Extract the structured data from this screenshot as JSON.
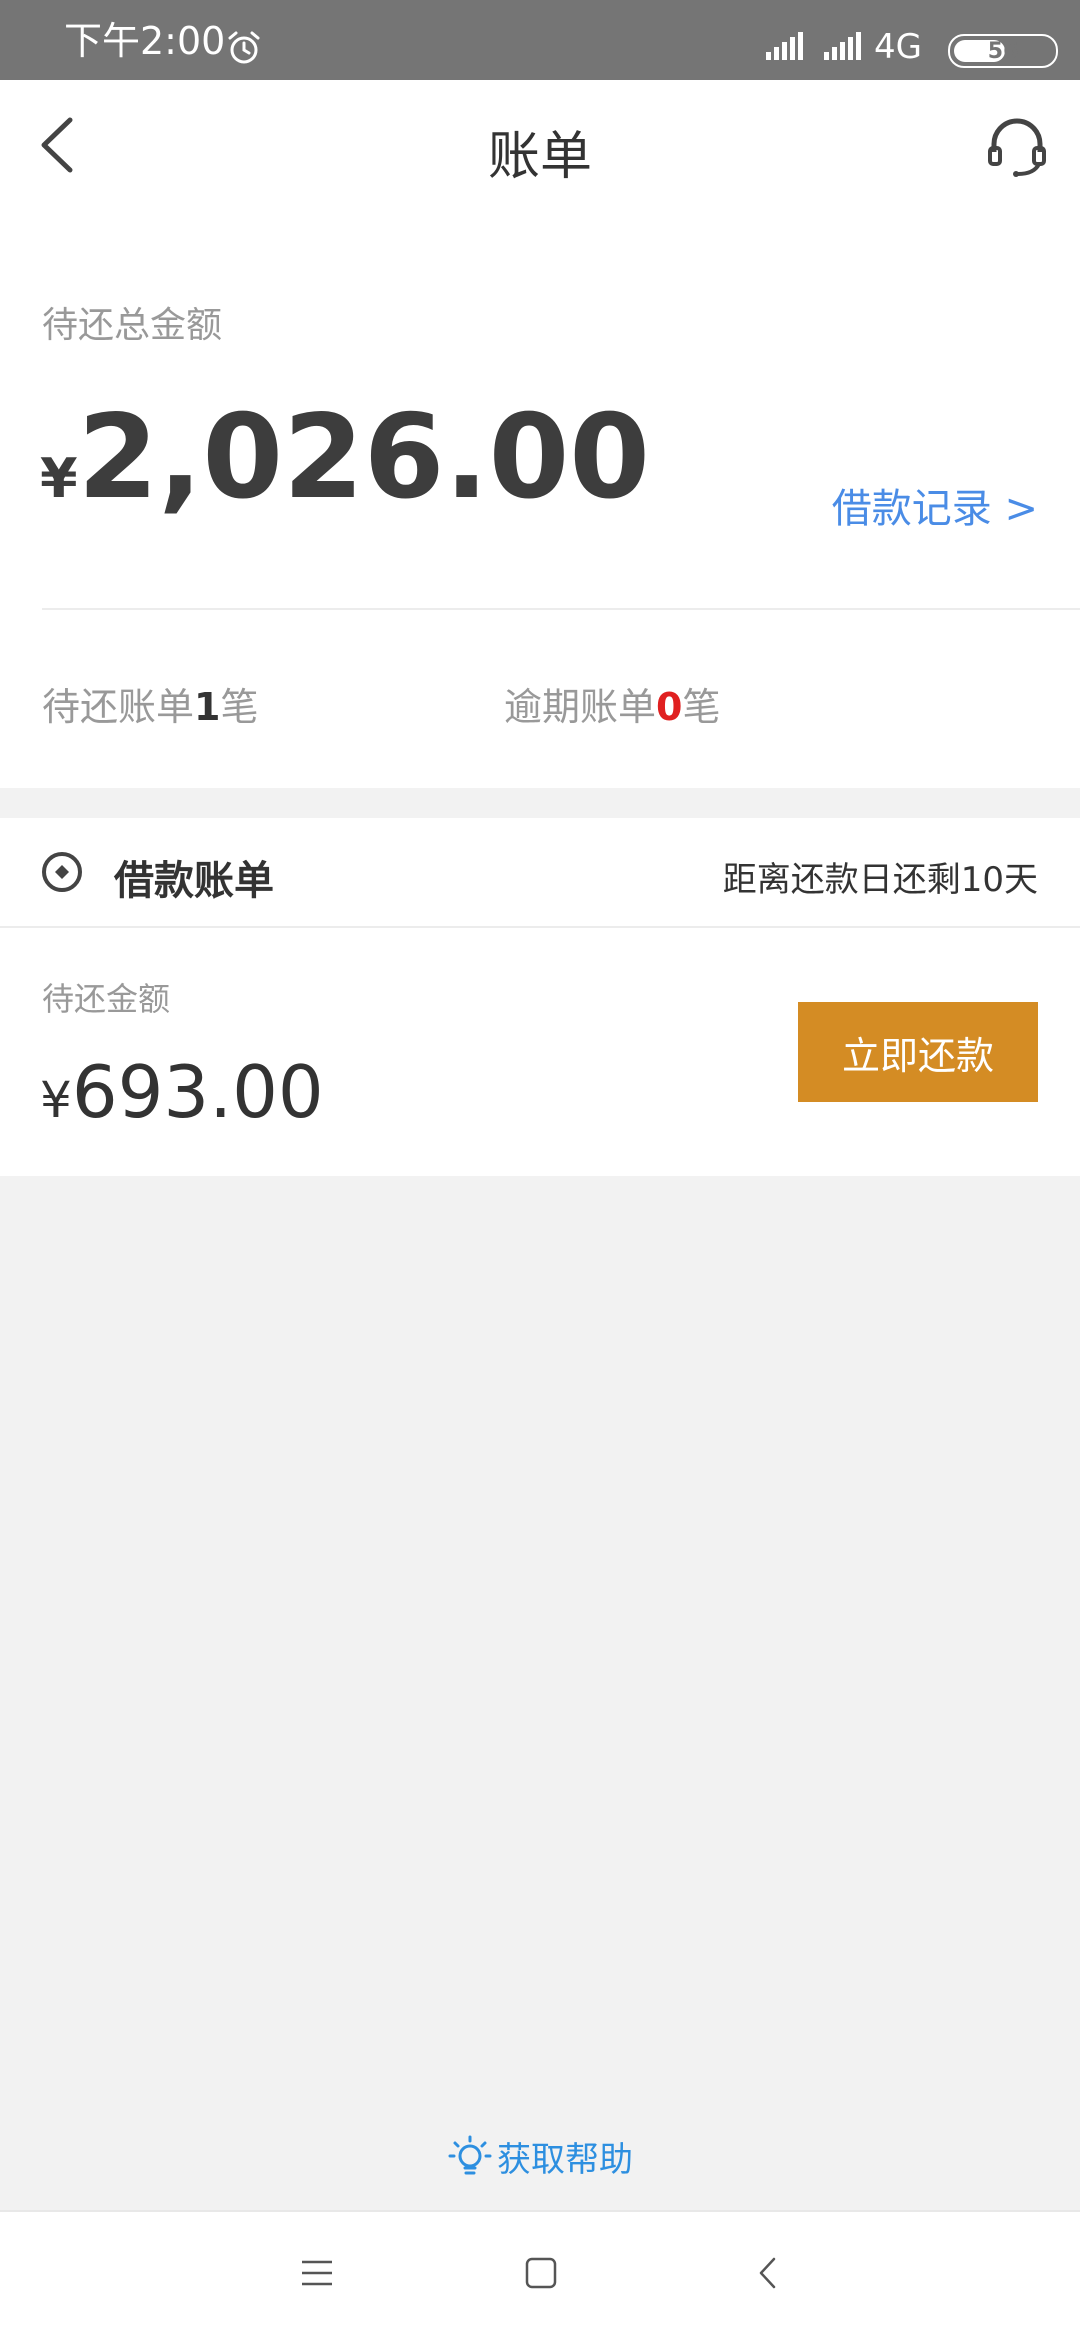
{
  "status_bar": {
    "time": "下午2:00",
    "network": "4G",
    "battery": "56",
    "battery_level": 0.56
  },
  "header": {
    "title": "账单"
  },
  "summary": {
    "label": "待还总金额",
    "currency": "¥",
    "amount": "2,026.00",
    "loan_record_link": "借款记录 >",
    "pending_prefix": "待还账单",
    "pending_count": "1",
    "pending_suffix": "笔",
    "overdue_prefix": "逾期账单",
    "overdue_count": "0",
    "overdue_suffix": "笔"
  },
  "loan_card": {
    "title": "借款账单",
    "due_text": "距离还款日还剩10天",
    "amount_label": "待还金额",
    "currency": "¥",
    "amount": "693.00",
    "pay_button": "立即还款"
  },
  "help": {
    "label": "获取帮助"
  },
  "colors": {
    "accent_blue": "#4a8ce6",
    "pay_button": "#d48c24",
    "overdue_red": "#e02020",
    "help_blue": "#2d8fe0"
  },
  "icons": [
    "alarm-icon",
    "signal-icon",
    "battery-icon",
    "back-arrow-icon",
    "headset-icon",
    "loan-icon",
    "lightbulb-icon",
    "menu-icon",
    "home-icon",
    "nav-back-icon"
  ]
}
